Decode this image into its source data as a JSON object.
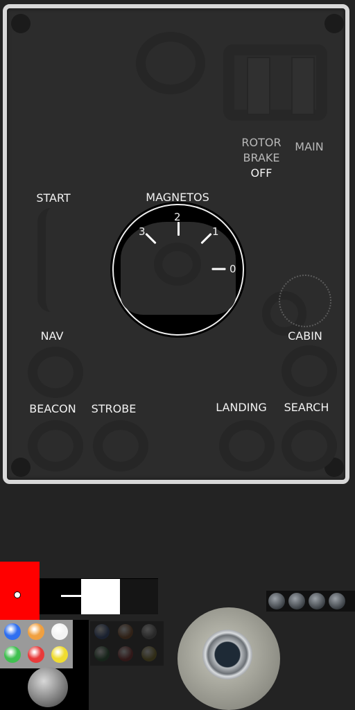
{
  "panel": {
    "labels": {
      "rotor_brake_line1": "ROTOR",
      "rotor_brake_line2": "BRAKE",
      "rotor_brake_off": "OFF",
      "main": "MAIN",
      "start": "START",
      "magnetos": "MAGNETOS",
      "nav": "NAV",
      "cabin": "CABIN",
      "beacon": "BEACON",
      "strobe": "STROBE",
      "landing": "LANDING",
      "search": "SEARCH"
    },
    "magneto_dial": {
      "positions": [
        "3",
        "2",
        "1",
        "0"
      ]
    }
  },
  "sprites": {
    "lamp_colors_lit": [
      "#2f6ff0",
      "#f0a040",
      "#f4f4f4",
      "#40c050",
      "#e83a3a",
      "#f0dc30"
    ],
    "lamp_colors_dim": [
      "#1a2a4a",
      "#4a2a12",
      "#3a3a3a",
      "#12301a",
      "#4a1414",
      "#4a4212"
    ],
    "accent_red": "#ff0000"
  }
}
